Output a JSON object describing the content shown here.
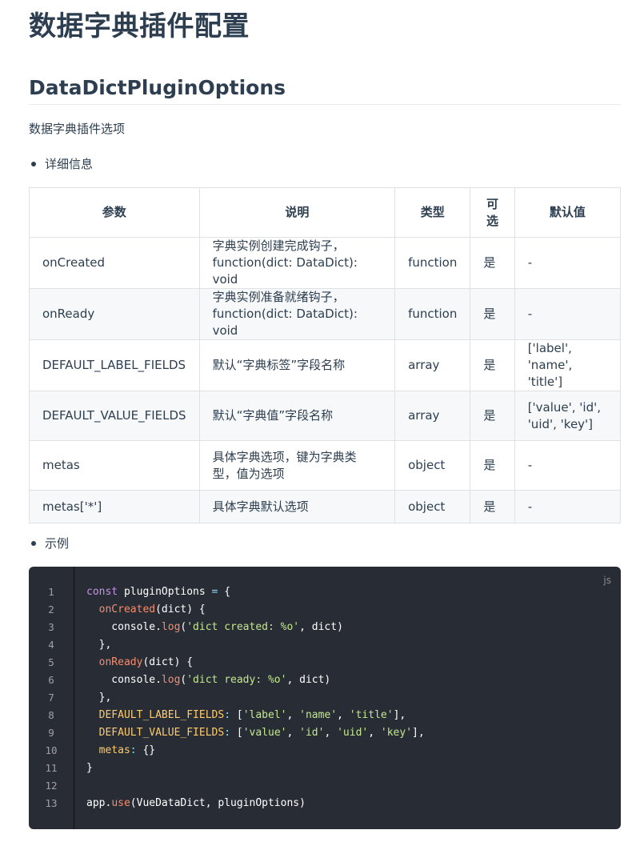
{
  "title": "数据字典插件配置",
  "subtitle": "DataDictPluginOptions",
  "description": "数据字典插件选项",
  "details_label": "详细信息",
  "example_label": "示例",
  "table": {
    "headers": [
      "参数",
      "说明",
      "类型",
      "可选",
      "默认值"
    ],
    "header_optional_lines": [
      "可",
      "选"
    ],
    "rows": [
      {
        "param": "onCreated",
        "desc1": "字典实例创建完成钩子，",
        "desc2": "function(dict: DataDict): void",
        "type": "function",
        "optional": "是",
        "default1": "-",
        "default2": ""
      },
      {
        "param": "onReady",
        "desc1": "字典实例准备就绪钩子，",
        "desc2": "function(dict: DataDict): void",
        "type": "function",
        "optional": "是",
        "default1": "-",
        "default2": ""
      },
      {
        "param": "DEFAULT_LABEL_FIELDS",
        "desc1": "默认“字典标签”字段名称",
        "desc2": "",
        "type": "array",
        "optional": "是",
        "default1": "['label',",
        "default2": "'name', 'title']"
      },
      {
        "param": "DEFAULT_VALUE_FIELDS",
        "desc1": "默认“字典值”字段名称",
        "desc2": "",
        "type": "array",
        "optional": "是",
        "default1": "['value', 'id',",
        "default2": "'uid', 'key']"
      },
      {
        "param": "metas",
        "desc1": "具体字典选项，键为字典类",
        "desc2": "型，值为选项",
        "type": "object",
        "optional": "是",
        "default1": "-",
        "default2": ""
      },
      {
        "param": "metas['*']",
        "desc1": "具体字典默认选项",
        "desc2": "",
        "type": "object",
        "optional": "是",
        "default1": "-",
        "default2": ""
      }
    ]
  },
  "code": {
    "language": "js",
    "line_numbers": [
      "1",
      "2",
      "3",
      "4",
      "5",
      "6",
      "7",
      "8",
      "9",
      "10",
      "11",
      "12",
      "13"
    ],
    "tokens": {
      "l1": [
        "const",
        " pluginOptions ",
        "=",
        " {"
      ],
      "l2": [
        "  ",
        "onCreated",
        "(dict) {"
      ],
      "l3": [
        "    console.",
        "log",
        "(",
        "'dict created: %o'",
        ", dict)"
      ],
      "l4": [
        "  },"
      ],
      "l5": [
        "  ",
        "onReady",
        "(dict) {"
      ],
      "l6": [
        "    console.",
        "log",
        "(",
        "'dict ready: %o'",
        ", dict)"
      ],
      "l7": [
        "  },"
      ],
      "l8": [
        "  ",
        "DEFAULT_LABEL_FIELDS",
        ":",
        " [",
        "'label'",
        ", ",
        "'name'",
        ", ",
        "'title'",
        "],"
      ],
      "l9": [
        "  ",
        "DEFAULT_VALUE_FIELDS",
        ":",
        " [",
        "'value'",
        ", ",
        "'id'",
        ", ",
        "'uid'",
        ", ",
        "'key'",
        "],"
      ],
      "l10": [
        "  ",
        "metas",
        ":",
        " {}"
      ],
      "l11": [
        "}"
      ],
      "l12": [
        ""
      ],
      "l13": [
        "app.",
        "use",
        "(VueDataDict, pluginOptions)"
      ]
    }
  },
  "colors": {
    "text": "#2c3e50",
    "code_bg": "#282c34",
    "keyword": "#c792ea",
    "function": "#f78c6c",
    "string": "#c3e88d",
    "property": "#ffcb6b",
    "operator": "#89ddff"
  }
}
